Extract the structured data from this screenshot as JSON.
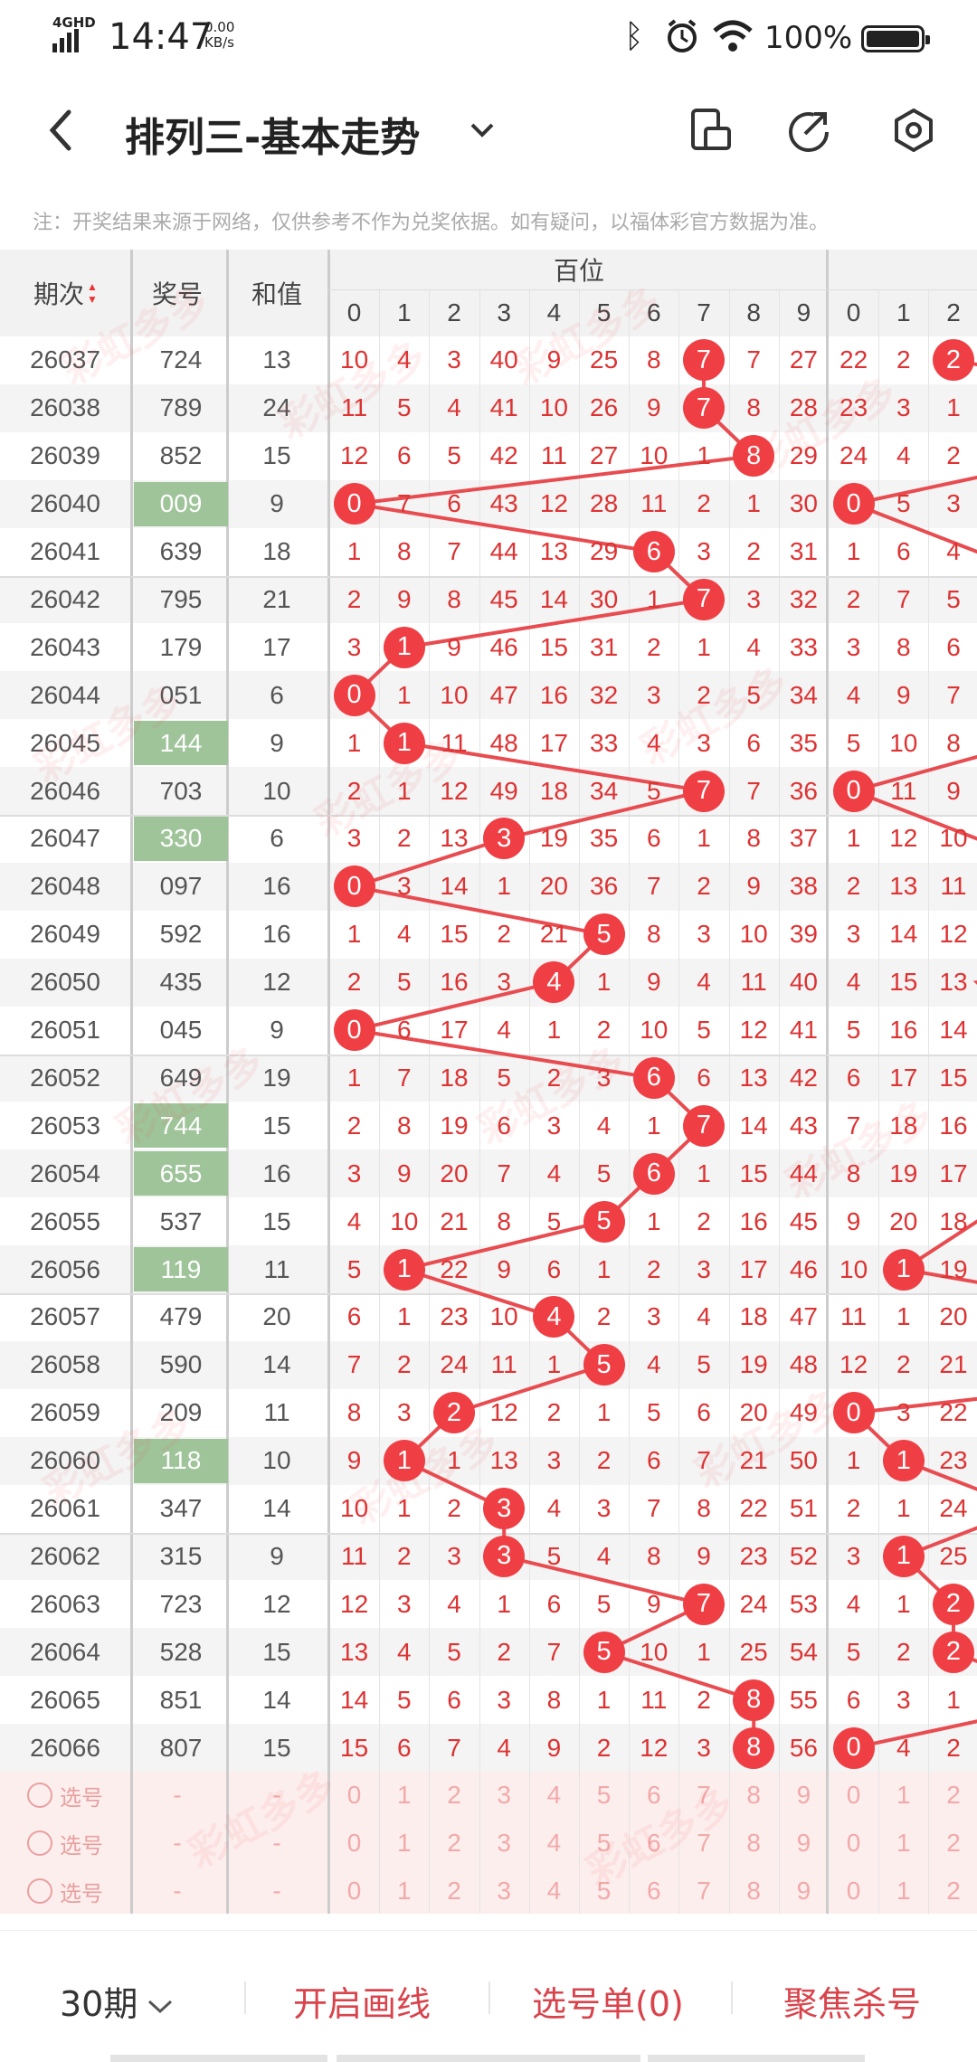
{
  "status": {
    "network": "4GHD",
    "time": "14:47",
    "speed_value": "0.00",
    "speed_unit": "KB/s",
    "battery": "100%"
  },
  "header": {
    "title": "排列三-基本走势"
  },
  "notice": "注：开奖结果来源于网络，仅供参考不作为兑奖依据。如有疑问，以福体彩官方数据为准。",
  "table": {
    "col_period": "期次",
    "col_number": "奖号",
    "col_sum": "和值",
    "group_hundreds": "百位",
    "digits": [
      "0",
      "1",
      "2",
      "3",
      "4",
      "5",
      "6",
      "7",
      "8",
      "9",
      "0",
      "1",
      "2"
    ],
    "rows": [
      {
        "p": "26037",
        "n": "724",
        "s": "13",
        "d": [
          "10",
          "4",
          "3",
          "40",
          "9",
          "25",
          "8",
          "7",
          "7",
          "27",
          "22",
          "2",
          "2"
        ]
      },
      {
        "p": "26038",
        "n": "789",
        "s": "24",
        "d": [
          "11",
          "5",
          "4",
          "41",
          "10",
          "26",
          "9",
          "7",
          "8",
          "28",
          "23",
          "3",
          "1"
        ]
      },
      {
        "p": "26039",
        "n": "852",
        "s": "15",
        "d": [
          "12",
          "6",
          "5",
          "42",
          "11",
          "27",
          "10",
          "1",
          "8",
          "29",
          "24",
          "4",
          "2"
        ]
      },
      {
        "p": "26040",
        "n": "009",
        "s": "9",
        "d": [
          "0",
          "7",
          "6",
          "43",
          "12",
          "28",
          "11",
          "2",
          "1",
          "30",
          "0",
          "5",
          "3"
        ]
      },
      {
        "p": "26041",
        "n": "639",
        "s": "18",
        "d": [
          "1",
          "8",
          "7",
          "44",
          "13",
          "29",
          "6",
          "3",
          "2",
          "31",
          "1",
          "6",
          "4"
        ]
      },
      {
        "p": "26042",
        "n": "795",
        "s": "21",
        "d": [
          "2",
          "9",
          "8",
          "45",
          "14",
          "30",
          "1",
          "7",
          "3",
          "32",
          "2",
          "7",
          "5"
        ]
      },
      {
        "p": "26043",
        "n": "179",
        "s": "17",
        "d": [
          "3",
          "1",
          "9",
          "46",
          "15",
          "31",
          "2",
          "1",
          "4",
          "33",
          "3",
          "8",
          "6"
        ]
      },
      {
        "p": "26044",
        "n": "051",
        "s": "6",
        "d": [
          "0",
          "1",
          "10",
          "47",
          "16",
          "32",
          "3",
          "2",
          "5",
          "34",
          "4",
          "9",
          "7"
        ]
      },
      {
        "p": "26045",
        "n": "144",
        "s": "9",
        "d": [
          "1",
          "1",
          "11",
          "48",
          "17",
          "33",
          "4",
          "3",
          "6",
          "35",
          "5",
          "10",
          "8"
        ]
      },
      {
        "p": "26046",
        "n": "703",
        "s": "10",
        "d": [
          "2",
          "1",
          "12",
          "49",
          "18",
          "34",
          "5",
          "7",
          "7",
          "36",
          "0",
          "11",
          "9"
        ]
      },
      {
        "p": "26047",
        "n": "330",
        "s": "6",
        "d": [
          "3",
          "2",
          "13",
          "3",
          "19",
          "35",
          "6",
          "1",
          "8",
          "37",
          "1",
          "12",
          "10"
        ]
      },
      {
        "p": "26048",
        "n": "097",
        "s": "16",
        "d": [
          "0",
          "3",
          "14",
          "1",
          "20",
          "36",
          "7",
          "2",
          "9",
          "38",
          "2",
          "13",
          "11"
        ]
      },
      {
        "p": "26049",
        "n": "592",
        "s": "16",
        "d": [
          "1",
          "4",
          "15",
          "2",
          "21",
          "5",
          "8",
          "3",
          "10",
          "39",
          "3",
          "14",
          "12"
        ]
      },
      {
        "p": "26050",
        "n": "435",
        "s": "12",
        "d": [
          "2",
          "5",
          "16",
          "3",
          "4",
          "1",
          "9",
          "4",
          "11",
          "40",
          "4",
          "15",
          "13"
        ]
      },
      {
        "p": "26051",
        "n": "045",
        "s": "9",
        "d": [
          "0",
          "6",
          "17",
          "4",
          "1",
          "2",
          "10",
          "5",
          "12",
          "41",
          "5",
          "16",
          "14"
        ]
      },
      {
        "p": "26052",
        "n": "649",
        "s": "19",
        "d": [
          "1",
          "7",
          "18",
          "5",
          "2",
          "3",
          "6",
          "6",
          "13",
          "42",
          "6",
          "17",
          "15"
        ]
      },
      {
        "p": "26053",
        "n": "744",
        "s": "15",
        "d": [
          "2",
          "8",
          "19",
          "6",
          "3",
          "4",
          "1",
          "7",
          "14",
          "43",
          "7",
          "18",
          "16"
        ]
      },
      {
        "p": "26054",
        "n": "655",
        "s": "16",
        "d": [
          "3",
          "9",
          "20",
          "7",
          "4",
          "5",
          "6",
          "1",
          "15",
          "44",
          "8",
          "19",
          "17"
        ]
      },
      {
        "p": "26055",
        "n": "537",
        "s": "15",
        "d": [
          "4",
          "10",
          "21",
          "8",
          "5",
          "5",
          "1",
          "2",
          "16",
          "45",
          "9",
          "20",
          "18"
        ]
      },
      {
        "p": "26056",
        "n": "119",
        "s": "11",
        "d": [
          "5",
          "1",
          "22",
          "9",
          "6",
          "1",
          "2",
          "3",
          "17",
          "46",
          "10",
          "1",
          "19"
        ]
      },
      {
        "p": "26057",
        "n": "479",
        "s": "20",
        "d": [
          "6",
          "1",
          "23",
          "10",
          "4",
          "2",
          "3",
          "4",
          "18",
          "47",
          "11",
          "1",
          "20"
        ]
      },
      {
        "p": "26058",
        "n": "590",
        "s": "14",
        "d": [
          "7",
          "2",
          "24",
          "11",
          "1",
          "5",
          "4",
          "5",
          "19",
          "48",
          "12",
          "2",
          "21"
        ]
      },
      {
        "p": "26059",
        "n": "209",
        "s": "11",
        "d": [
          "8",
          "3",
          "2",
          "12",
          "2",
          "1",
          "5",
          "6",
          "20",
          "49",
          "0",
          "3",
          "22"
        ]
      },
      {
        "p": "26060",
        "n": "118",
        "s": "10",
        "d": [
          "9",
          "1",
          "1",
          "13",
          "3",
          "2",
          "6",
          "7",
          "21",
          "50",
          "1",
          "1",
          "23"
        ]
      },
      {
        "p": "26061",
        "n": "347",
        "s": "14",
        "d": [
          "10",
          "1",
          "2",
          "3",
          "4",
          "3",
          "7",
          "8",
          "22",
          "51",
          "2",
          "1",
          "24"
        ]
      },
      {
        "p": "26062",
        "n": "315",
        "s": "9",
        "d": [
          "11",
          "2",
          "3",
          "3",
          "5",
          "4",
          "8",
          "9",
          "23",
          "52",
          "3",
          "1",
          "25"
        ]
      },
      {
        "p": "26063",
        "n": "723",
        "s": "12",
        "d": [
          "12",
          "3",
          "4",
          "1",
          "6",
          "5",
          "9",
          "7",
          "24",
          "53",
          "4",
          "1",
          "2"
        ]
      },
      {
        "p": "26064",
        "n": "528",
        "s": "15",
        "d": [
          "13",
          "4",
          "5",
          "2",
          "7",
          "5",
          "10",
          "1",
          "25",
          "54",
          "5",
          "2",
          "2"
        ]
      },
      {
        "p": "26065",
        "n": "851",
        "s": "14",
        "d": [
          "14",
          "5",
          "6",
          "3",
          "8",
          "1",
          "11",
          "2",
          "8",
          "55",
          "6",
          "3",
          "1"
        ]
      },
      {
        "p": "26066",
        "n": "807",
        "s": "15",
        "d": [
          "15",
          "6",
          "7",
          "4",
          "9",
          "2",
          "12",
          "3",
          "8",
          "56",
          "0",
          "4",
          "2"
        ]
      }
    ],
    "pick_label": "选号",
    "dash": "-",
    "pick_digits": [
      "0",
      "1",
      "2",
      "3",
      "4",
      "5",
      "6",
      "7",
      "8",
      "9",
      "0",
      "1",
      "2"
    ]
  },
  "bottom": {
    "periods": "30期",
    "draw_lines": "开启画线",
    "pick_list": "选号单(0)",
    "focus": "聚焦杀号"
  },
  "colors": {
    "ball": "#ef3f44",
    "line": "#e84c50",
    "highlight": "#9fc49a",
    "miss_text": "#d33"
  }
}
